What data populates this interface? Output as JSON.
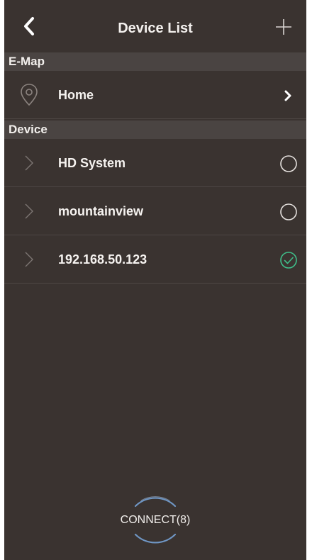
{
  "header": {
    "title": "Device List",
    "back_icon": "chevron-left-icon",
    "add_icon": "plus-icon"
  },
  "emap_section": {
    "label": "E-Map",
    "items": [
      {
        "label": "Home",
        "left_icon": "location-pin-icon",
        "right_icon": "chevron-right-icon"
      }
    ]
  },
  "device_section": {
    "label": "Device",
    "items": [
      {
        "label": "HD System",
        "selected": false
      },
      {
        "label": "mountainview",
        "selected": false
      },
      {
        "label": "192.168.50.123",
        "selected": true
      }
    ]
  },
  "connect": {
    "label": "CONNECT(8)"
  },
  "colors": {
    "background": "#3a3330",
    "section_bar": "#4a4442",
    "selected_check": "#3fbf8a",
    "connect_ring": "#5b8fc9"
  }
}
